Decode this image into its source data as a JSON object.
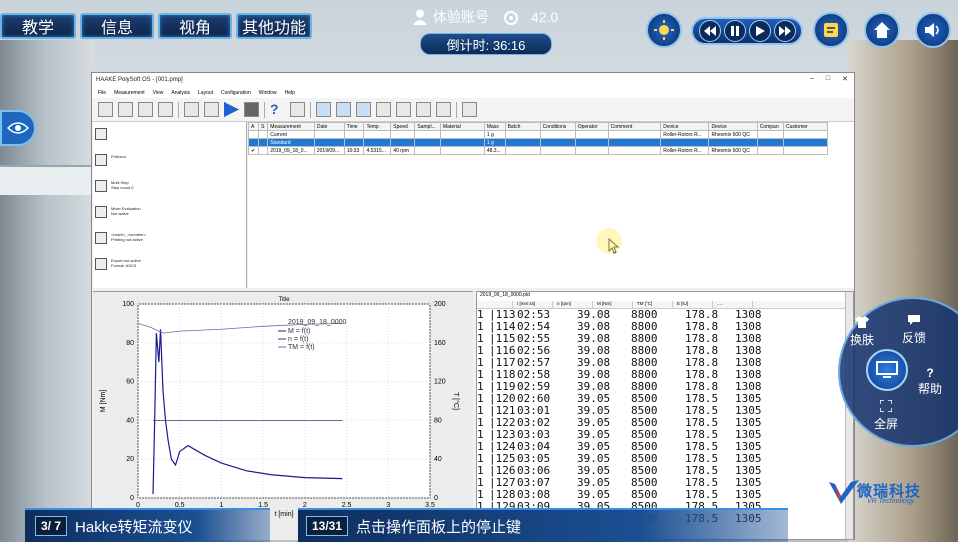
{
  "top_nav": [
    "教学",
    "信息",
    "视角",
    "其他功能"
  ],
  "account": {
    "label": "体验账号",
    "score": "42.0"
  },
  "timer": "倒计时: 36:16",
  "app": {
    "title": "HAAKE PolySoft OS - [001.pmp]",
    "menu": [
      "File",
      "Measurement",
      "View",
      "Analysis",
      "Layout",
      "Configuration",
      "Window",
      "Help"
    ],
    "workflow": [
      {
        "title": "",
        "sub": ""
      },
      {
        "title": "Protocol",
        "sub": ""
      },
      {
        "title": "Multi Step",
        "sub": "Step count 0"
      },
      {
        "title": "Mixer Evaluation",
        "sub": "Not active"
      },
      {
        "title": "<batch>_<number>",
        "sub": "Printing not active"
      },
      {
        "title": "Export not active",
        "sub": "Format: ASCII"
      }
    ],
    "table_headers": [
      "A",
      "S",
      "Measurement",
      "Date",
      "Time",
      "Temp",
      "Speed",
      "Sampl...",
      "Material",
      "Mass",
      "Batch",
      "Conditions",
      "Operator",
      "Comment",
      "Device",
      "Device",
      "Compan",
      "Customer"
    ],
    "table_rows": [
      [
        "",
        "",
        "Current",
        "",
        "",
        "",
        "",
        "",
        "",
        "1 g",
        "",
        "",
        "",
        "",
        "Roller-Rotors R...",
        "Rheomix 600 QC",
        "",
        ""
      ],
      [
        "",
        "",
        "Standard",
        "",
        "",
        "",
        "",
        "",
        "",
        "1 g",
        "",
        "",
        "",
        "",
        "",
        "",
        "",
        ""
      ],
      [
        "✔",
        "",
        "2019_09_18_0...",
        "2019/09...",
        "10:33",
        "4.5315...",
        "40 rpm",
        "",
        "",
        "48.3...",
        "",
        "",
        "",
        "",
        "Roller-Rotors R...",
        "Rheomix 600 QC",
        "",
        ""
      ]
    ],
    "data_file": "2019_09_18_0000.pld",
    "data_headers": [
      "t [mm:ss]",
      "n [rpm]",
      "M [Nm]",
      "TM [°C]",
      "E [kJ]"
    ],
    "data_rows": [
      [
        "1",
        "113",
        "02:53",
        "39.08",
        "8800",
        "178.8",
        "1308"
      ],
      [
        "1",
        "114",
        "02:54",
        "39.08",
        "8800",
        "178.8",
        "1308"
      ],
      [
        "1",
        "115",
        "02:55",
        "39.08",
        "8800",
        "178.8",
        "1308"
      ],
      [
        "1",
        "116",
        "02:56",
        "39.08",
        "8800",
        "178.8",
        "1308"
      ],
      [
        "1",
        "117",
        "02:57",
        "39.08",
        "8800",
        "178.8",
        "1308"
      ],
      [
        "1",
        "118",
        "02:58",
        "39.08",
        "8800",
        "178.8",
        "1308"
      ],
      [
        "1",
        "119",
        "02:59",
        "39.08",
        "8800",
        "178.8",
        "1308"
      ],
      [
        "1",
        "120",
        "02:60",
        "39.05",
        "8500",
        "178.5",
        "1305"
      ],
      [
        "1",
        "121",
        "03:01",
        "39.05",
        "8500",
        "178.5",
        "1305"
      ],
      [
        "1",
        "122",
        "03:02",
        "39.05",
        "8500",
        "178.5",
        "1305"
      ],
      [
        "1",
        "123",
        "03:03",
        "39.05",
        "8500",
        "178.5",
        "1305"
      ],
      [
        "1",
        "124",
        "03:04",
        "39.05",
        "8500",
        "178.5",
        "1305"
      ],
      [
        "1",
        "125",
        "03:05",
        "39.05",
        "8500",
        "178.5",
        "1305"
      ],
      [
        "1",
        "126",
        "03:06",
        "39.05",
        "8500",
        "178.5",
        "1305"
      ],
      [
        "1",
        "127",
        "03:07",
        "39.05",
        "8500",
        "178.5",
        "1305"
      ],
      [
        "1",
        "128",
        "03:08",
        "39.05",
        "8500",
        "178.5",
        "1305"
      ],
      [
        "1",
        "129",
        "03:09",
        "39.05",
        "8500",
        "178.5",
        "1305"
      ],
      [
        "1",
        "130",
        "03:10",
        "39.05",
        "8500",
        "178.5",
        "1305"
      ]
    ]
  },
  "chart_data": {
    "type": "line",
    "title": "Title",
    "xlabel": "t [min]",
    "ylabel": "M [Nm]",
    "y2label": "T [°C]",
    "xlim": [
      0,
      3.5
    ],
    "ylim": [
      0,
      100
    ],
    "y2lim": [
      0,
      200
    ],
    "xticks": [
      "0",
      "0.5",
      "1",
      "1.5",
      "2",
      "2.5",
      "3",
      "3.5"
    ],
    "yticks": [
      "0",
      "20",
      "40",
      "60",
      "80",
      "100"
    ],
    "y2ticks": [
      "0",
      "40",
      "80",
      "120",
      "160",
      "200"
    ],
    "legend_title": "2019_09_18_0000",
    "legend": [
      "M = f(t)",
      "n = f(t)",
      "TM = f(t)"
    ],
    "series": [
      {
        "name": "M = f(t)",
        "x": [
          0.18,
          0.2,
          0.22,
          0.25,
          0.27,
          0.3,
          0.33,
          0.36,
          0.4,
          0.45,
          0.5,
          0.6,
          0.8,
          1.0,
          1.3,
          1.6,
          2.0,
          2.45
        ],
        "values": [
          2,
          40,
          85,
          70,
          87,
          55,
          40,
          30,
          20,
          17,
          24,
          27,
          22,
          18,
          14,
          12,
          10.5,
          10
        ]
      },
      {
        "name": "n = f(t)",
        "x": [
          0.18,
          0.22,
          0.3,
          0.45,
          0.5,
          1.0,
          2.0,
          2.45
        ],
        "values": [
          40,
          40,
          40,
          40,
          40,
          40,
          40,
          40
        ]
      },
      {
        "name": "TM = f(t)",
        "x": [
          0.0,
          0.15,
          0.3,
          0.5,
          1.0,
          1.5,
          2.0,
          2.45
        ],
        "values": [
          90,
          88,
          85,
          86,
          87,
          88.5,
          89.5,
          90
        ]
      }
    ]
  },
  "radial_menu": [
    "换肤",
    "反馈",
    "帮助",
    "全屏"
  ],
  "brand": {
    "name": "微瑞科技",
    "sub": "VR Technology"
  },
  "bottom": {
    "left_badge": "3/ 7",
    "left_text": "Hakke转矩流变仪",
    "mid_badge": "13/31",
    "mid_text": "点击操作面板上的停止键"
  },
  "colors": {
    "hud_blue": "#1b4f92",
    "selection": "#1f7ad6",
    "series": "#1a1a8c"
  }
}
